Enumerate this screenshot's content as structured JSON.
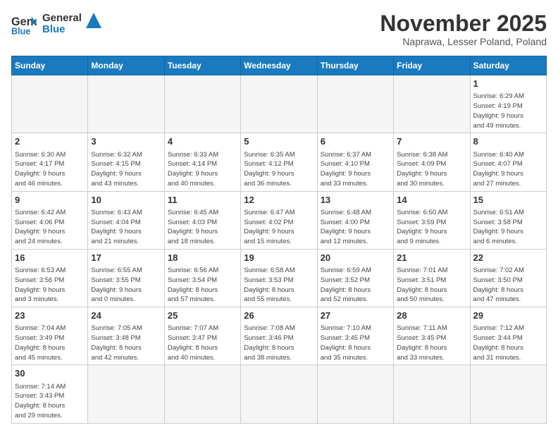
{
  "logo": {
    "text_general": "General",
    "text_blue": "Blue"
  },
  "header": {
    "title": "November 2025",
    "subtitle": "Naprawa, Lesser Poland, Poland"
  },
  "weekdays": [
    "Sunday",
    "Monday",
    "Tuesday",
    "Wednesday",
    "Thursday",
    "Friday",
    "Saturday"
  ],
  "weeks": [
    [
      {
        "day": null
      },
      {
        "day": null
      },
      {
        "day": null
      },
      {
        "day": null
      },
      {
        "day": null
      },
      {
        "day": null
      },
      {
        "day": "1",
        "info": "Sunrise: 6:29 AM\nSunset: 4:19 PM\nDaylight: 9 hours\nand 49 minutes."
      }
    ],
    [
      {
        "day": "2",
        "info": "Sunrise: 6:30 AM\nSunset: 4:17 PM\nDaylight: 9 hours\nand 46 minutes."
      },
      {
        "day": "3",
        "info": "Sunrise: 6:32 AM\nSunset: 4:15 PM\nDaylight: 9 hours\nand 43 minutes."
      },
      {
        "day": "4",
        "info": "Sunrise: 6:33 AM\nSunset: 4:14 PM\nDaylight: 9 hours\nand 40 minutes."
      },
      {
        "day": "5",
        "info": "Sunrise: 6:35 AM\nSunset: 4:12 PM\nDaylight: 9 hours\nand 36 minutes."
      },
      {
        "day": "6",
        "info": "Sunrise: 6:37 AM\nSunset: 4:10 PM\nDaylight: 9 hours\nand 33 minutes."
      },
      {
        "day": "7",
        "info": "Sunrise: 6:38 AM\nSunset: 4:09 PM\nDaylight: 9 hours\nand 30 minutes."
      },
      {
        "day": "8",
        "info": "Sunrise: 6:40 AM\nSunset: 4:07 PM\nDaylight: 9 hours\nand 27 minutes."
      }
    ],
    [
      {
        "day": "9",
        "info": "Sunrise: 6:42 AM\nSunset: 4:06 PM\nDaylight: 9 hours\nand 24 minutes."
      },
      {
        "day": "10",
        "info": "Sunrise: 6:43 AM\nSunset: 4:04 PM\nDaylight: 9 hours\nand 21 minutes."
      },
      {
        "day": "11",
        "info": "Sunrise: 6:45 AM\nSunset: 4:03 PM\nDaylight: 9 hours\nand 18 minutes."
      },
      {
        "day": "12",
        "info": "Sunrise: 6:47 AM\nSunset: 4:02 PM\nDaylight: 9 hours\nand 15 minutes."
      },
      {
        "day": "13",
        "info": "Sunrise: 6:48 AM\nSunset: 4:00 PM\nDaylight: 9 hours\nand 12 minutes."
      },
      {
        "day": "14",
        "info": "Sunrise: 6:50 AM\nSunset: 3:59 PM\nDaylight: 9 hours\nand 9 minutes."
      },
      {
        "day": "15",
        "info": "Sunrise: 6:51 AM\nSunset: 3:58 PM\nDaylight: 9 hours\nand 6 minutes."
      }
    ],
    [
      {
        "day": "16",
        "info": "Sunrise: 6:53 AM\nSunset: 3:56 PM\nDaylight: 9 hours\nand 3 minutes."
      },
      {
        "day": "17",
        "info": "Sunrise: 6:55 AM\nSunset: 3:55 PM\nDaylight: 9 hours\nand 0 minutes."
      },
      {
        "day": "18",
        "info": "Sunrise: 6:56 AM\nSunset: 3:54 PM\nDaylight: 8 hours\nand 57 minutes."
      },
      {
        "day": "19",
        "info": "Sunrise: 6:58 AM\nSunset: 3:53 PM\nDaylight: 8 hours\nand 55 minutes."
      },
      {
        "day": "20",
        "info": "Sunrise: 6:59 AM\nSunset: 3:52 PM\nDaylight: 8 hours\nand 52 minutes."
      },
      {
        "day": "21",
        "info": "Sunrise: 7:01 AM\nSunset: 3:51 PM\nDaylight: 8 hours\nand 50 minutes."
      },
      {
        "day": "22",
        "info": "Sunrise: 7:02 AM\nSunset: 3:50 PM\nDaylight: 8 hours\nand 47 minutes."
      }
    ],
    [
      {
        "day": "23",
        "info": "Sunrise: 7:04 AM\nSunset: 3:49 PM\nDaylight: 8 hours\nand 45 minutes."
      },
      {
        "day": "24",
        "info": "Sunrise: 7:05 AM\nSunset: 3:48 PM\nDaylight: 8 hours\nand 42 minutes."
      },
      {
        "day": "25",
        "info": "Sunrise: 7:07 AM\nSunset: 3:47 PM\nDaylight: 8 hours\nand 40 minutes."
      },
      {
        "day": "26",
        "info": "Sunrise: 7:08 AM\nSunset: 3:46 PM\nDaylight: 8 hours\nand 38 minutes."
      },
      {
        "day": "27",
        "info": "Sunrise: 7:10 AM\nSunset: 3:45 PM\nDaylight: 8 hours\nand 35 minutes."
      },
      {
        "day": "28",
        "info": "Sunrise: 7:11 AM\nSunset: 3:45 PM\nDaylight: 8 hours\nand 33 minutes."
      },
      {
        "day": "29",
        "info": "Sunrise: 7:12 AM\nSunset: 3:44 PM\nDaylight: 8 hours\nand 31 minutes."
      }
    ],
    [
      {
        "day": "30",
        "info": "Sunrise: 7:14 AM\nSunset: 3:43 PM\nDaylight: 8 hours\nand 29 minutes."
      },
      {
        "day": null
      },
      {
        "day": null
      },
      {
        "day": null
      },
      {
        "day": null
      },
      {
        "day": null
      },
      {
        "day": null
      }
    ]
  ]
}
